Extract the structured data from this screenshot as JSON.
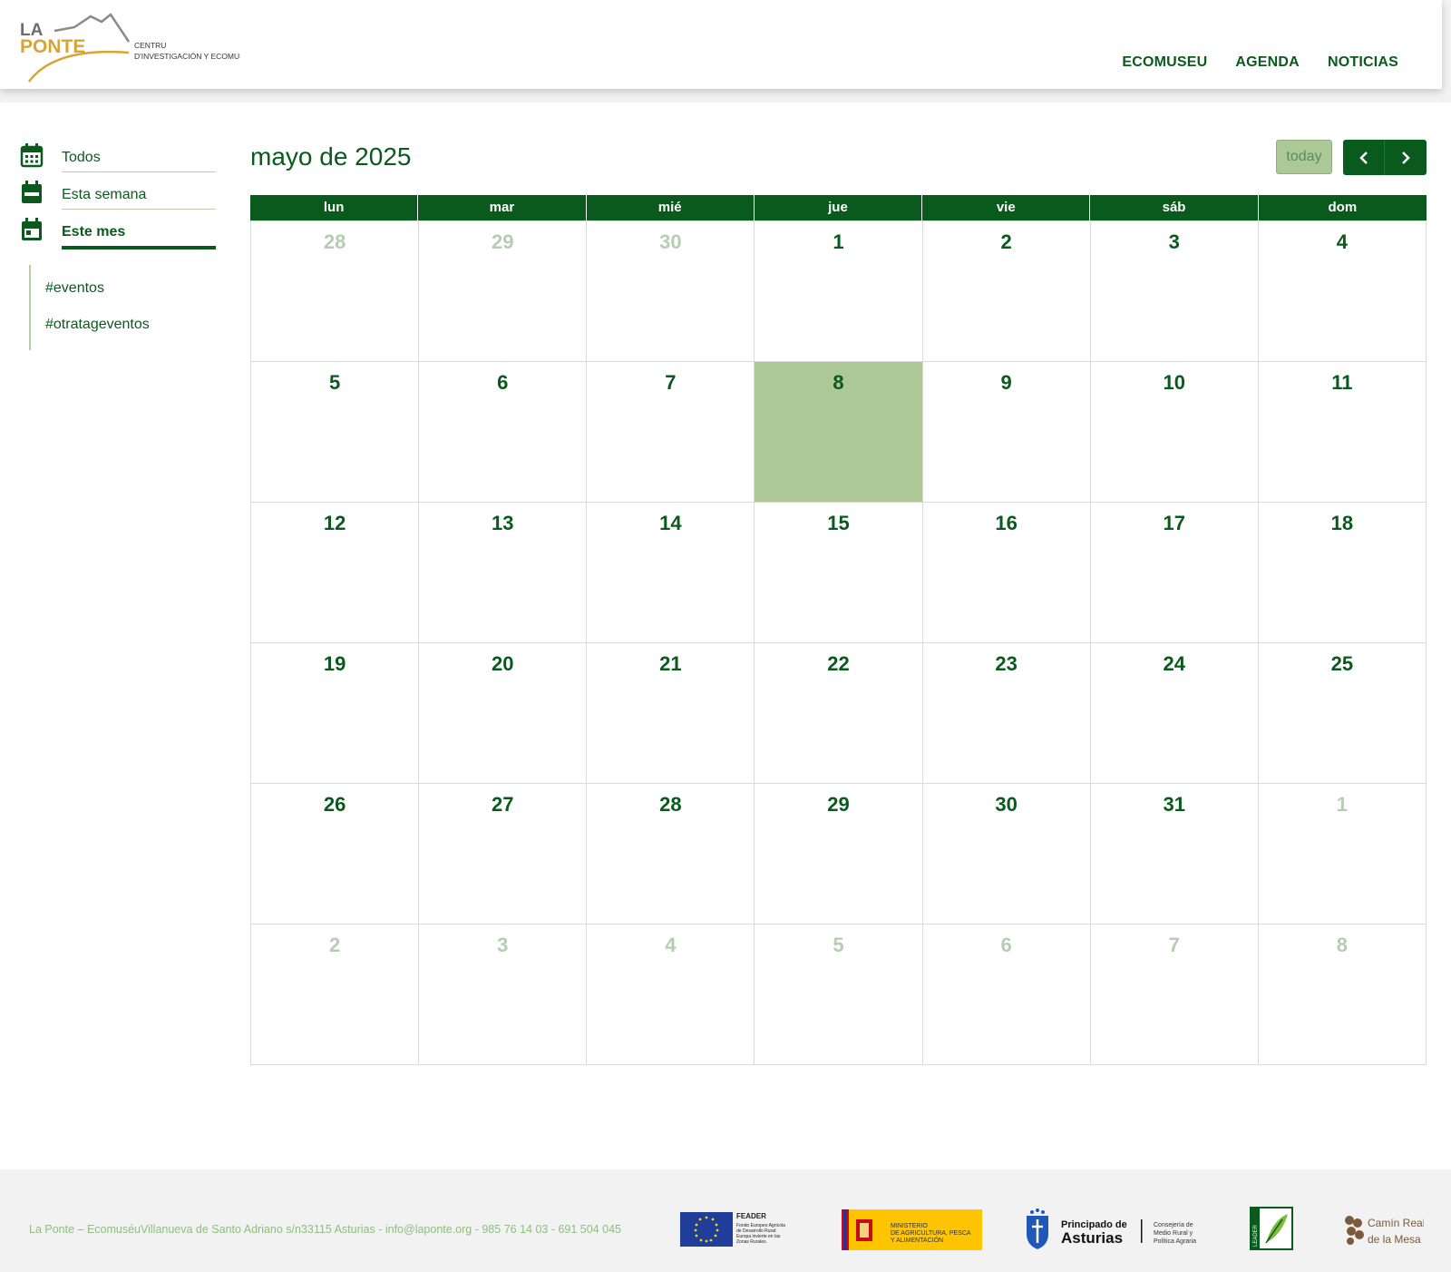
{
  "header": {
    "logo": {
      "line1": "LA",
      "line2": "PONTE",
      "tagline1": "CENTRU",
      "tagline2": "D'INVESTIGACIÓN Y ECOMUSÉU"
    },
    "nav": [
      {
        "label": "ECOMUSEU"
      },
      {
        "label": "AGENDA"
      },
      {
        "label": "NOTICIAS"
      }
    ]
  },
  "sidebar": {
    "items": [
      {
        "label": "Todos",
        "icon": "calendar-grid-icon"
      },
      {
        "label": "Esta semana",
        "icon": "calendar-week-icon"
      },
      {
        "label": "Este mes",
        "icon": "calendar-month-icon",
        "active": true
      }
    ],
    "tags": [
      {
        "label": "#eventos"
      },
      {
        "label": "#otratageventos"
      }
    ]
  },
  "calendar": {
    "title": "mayo de 2025",
    "today_label": "today",
    "prev_icon": "chevron-left-icon",
    "next_icon": "chevron-right-icon",
    "days_of_week": [
      "lun",
      "mar",
      "mié",
      "jue",
      "vie",
      "sáb",
      "dom"
    ],
    "weeks": [
      [
        {
          "d": "28",
          "o": true
        },
        {
          "d": "29",
          "o": true
        },
        {
          "d": "30",
          "o": true
        },
        {
          "d": "1"
        },
        {
          "d": "2"
        },
        {
          "d": "3"
        },
        {
          "d": "4"
        }
      ],
      [
        {
          "d": "5"
        },
        {
          "d": "6"
        },
        {
          "d": "7"
        },
        {
          "d": "8",
          "t": true
        },
        {
          "d": "9"
        },
        {
          "d": "10"
        },
        {
          "d": "11"
        }
      ],
      [
        {
          "d": "12"
        },
        {
          "d": "13"
        },
        {
          "d": "14"
        },
        {
          "d": "15"
        },
        {
          "d": "16"
        },
        {
          "d": "17"
        },
        {
          "d": "18"
        }
      ],
      [
        {
          "d": "19"
        },
        {
          "d": "20"
        },
        {
          "d": "21"
        },
        {
          "d": "22"
        },
        {
          "d": "23"
        },
        {
          "d": "24"
        },
        {
          "d": "25"
        }
      ],
      [
        {
          "d": "26"
        },
        {
          "d": "27"
        },
        {
          "d": "28"
        },
        {
          "d": "29"
        },
        {
          "d": "30"
        },
        {
          "d": "31"
        },
        {
          "d": "1",
          "o": true
        }
      ],
      [
        {
          "d": "2",
          "o": true
        },
        {
          "d": "3",
          "o": true
        },
        {
          "d": "4",
          "o": true
        },
        {
          "d": "5",
          "o": true
        },
        {
          "d": "6",
          "o": true
        },
        {
          "d": "7",
          "o": true
        },
        {
          "d": "8",
          "o": true
        }
      ]
    ]
  },
  "footer": {
    "text": "La Ponte – EcomuséuVillanueva de Santo Adriano s/n33115 Asturias - info@laponte.org - 985 76 14 03 - 691 504 045",
    "logos": {
      "feader": {
        "title": "FEADER",
        "lines": [
          "Fondo Europeo Agrícola",
          "de Desarrollo Rural:",
          "Europa invierte en las",
          "Zonas Rurales."
        ]
      },
      "ministerio": {
        "lines": [
          "MINISTERIO",
          "DE AGRICULTURA, PESCA",
          "Y ALIMENTACIÓN"
        ]
      },
      "asturias": {
        "line1": "Principado de",
        "line2": "Asturias",
        "sub": [
          "Consejería de",
          "Medio Rural y",
          "Política Agraria"
        ]
      },
      "leader": {
        "label": "LEADER"
      },
      "camin": {
        "line1": "Camín Real",
        "line2": "de la Mesa"
      }
    }
  },
  "colors": {
    "brand_green": "#0b5a1d",
    "light_green": "#abc896",
    "logo_gold": "#d9a532",
    "muted_text": "#8fbc80"
  }
}
